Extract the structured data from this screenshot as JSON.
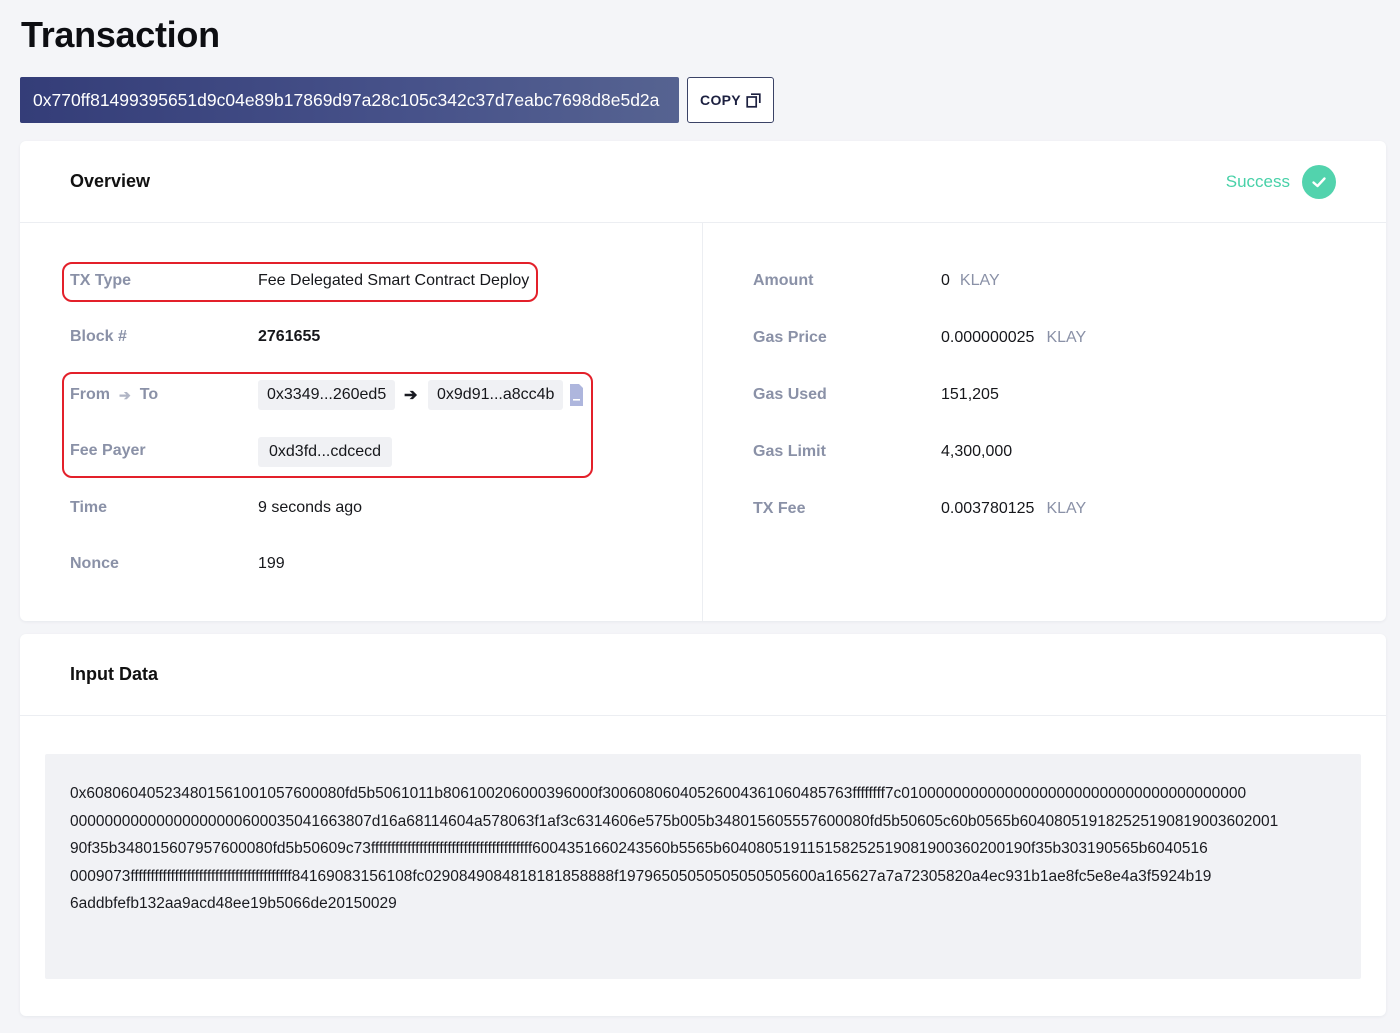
{
  "page_title": "Transaction",
  "tx_hash": "0x770ff81499395651d9c04e89b17869d97a28c105c342c37d7eabc7698d8e5d2a",
  "copy_label": "COPY",
  "overview": {
    "title": "Overview",
    "status": "Success",
    "status_color": "#48d1a8",
    "left": {
      "tx_type_label": "TX Type",
      "tx_type_value": "Fee Delegated Smart Contract Deploy",
      "block_label": "Block #",
      "block_value": "2761655",
      "from_label": "From",
      "to_label": "To",
      "from_value": "0x3349...260ed5",
      "to_value": "0x9d91...a8cc4b",
      "fee_payer_label": "Fee Payer",
      "fee_payer_value": "0xd3fd...cdcecd",
      "time_label": "Time",
      "time_value": "9 seconds ago",
      "nonce_label": "Nonce",
      "nonce_value": "199"
    },
    "right": {
      "amount_label": "Amount",
      "amount_value": "0",
      "amount_unit": "KLAY",
      "gas_price_label": "Gas Price",
      "gas_price_value": "0.000000025",
      "gas_price_unit": "KLAY",
      "gas_used_label": "Gas Used",
      "gas_used_value": "151,205",
      "gas_limit_label": "Gas Limit",
      "gas_limit_value": "4,300,000",
      "tx_fee_label": "TX Fee",
      "tx_fee_value": "0.003780125",
      "tx_fee_unit": "KLAY"
    }
  },
  "input_data": {
    "title": "Input Data",
    "lines": [
      "0x608060405234801561001057600080fd5b5061011b806100206000396000f3006080604052600436106048576​3ffffffff7c0100000000000000000000000000000000000000",
      "00000000000000000000600035041663807d16a68114604a578063f1af3c6314606e575b005b348015605557600080fd5b50605c60b0565b60408051918252519081900360200​1",
      "90f35b348015607957600080fd5b50609c73ffffffffffffffffffffffffffffffffffffffff6004351660243560b5565b604080519115158252519081900360200190f35b303190565b6040516",
      "0009073ffffffffffffffffffffffffffffffffffffffff841690831561​08fc0290849084818181858888f19796505050505050505600a165627a7a72305820a4ec931b1ae8fc5e8e4a3f5924b19",
      "6addbfefb132aa9acd48ee19b5066de20150029"
    ]
  }
}
